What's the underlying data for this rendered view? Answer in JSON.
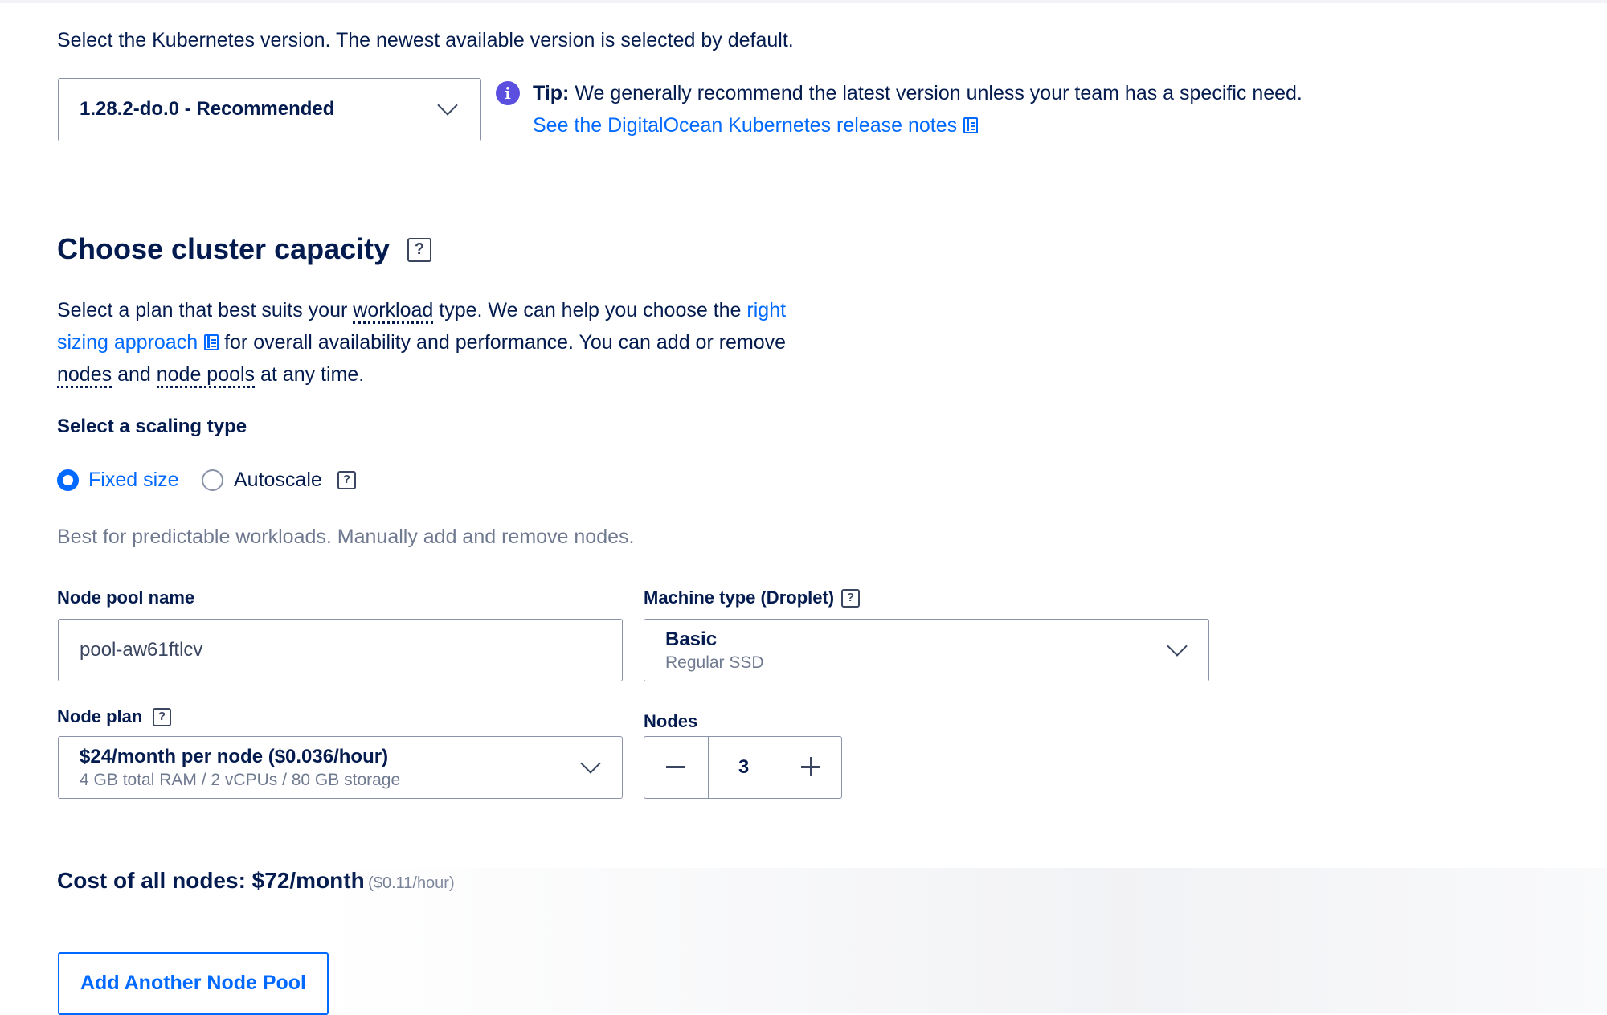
{
  "version_section": {
    "description": "Select the Kubernetes version. The newest available version is selected by default.",
    "selected_version": "1.28.2-do.0 - Recommended",
    "tip_label": "Tip:",
    "tip_text": "We generally recommend the latest version unless your team has a specific need.",
    "release_notes_link": "See the DigitalOcean Kubernetes release notes"
  },
  "capacity": {
    "title": "Choose cluster capacity",
    "desc_part1": "Select a plan that best suits your ",
    "desc_workload": "workload",
    "desc_part2": " type. We can help you choose the ",
    "desc_link_1": "right",
    "desc_link_2": "sizing approach",
    "desc_part3": " for overall availability and performance. You can add or remove",
    "desc_nodes": "nodes",
    "desc_and": " and ",
    "desc_node_pools": "node pools",
    "desc_part4": " at any time.",
    "scaling_label": "Select a scaling type",
    "scaling_options": [
      {
        "label": "Fixed size",
        "selected": true
      },
      {
        "label": "Autoscale",
        "selected": false
      }
    ],
    "scaling_hint": "Best for predictable workloads. Manually add and remove nodes."
  },
  "node_pool": {
    "name_label": "Node pool name",
    "name_value": "pool-aw61ftlcv",
    "machine_label": "Machine type (Droplet)",
    "machine_title": "Basic",
    "machine_sub": "Regular SSD",
    "plan_label": "Node plan",
    "plan_title": "$24/month per node ($0.036/hour)",
    "plan_sub": "4 GB total RAM / 2 vCPUs / 80 GB storage",
    "nodes_label": "Nodes",
    "nodes_value": "3"
  },
  "cost": {
    "label": "Cost of all nodes: $72/month",
    "hourly": "($0.11/hour)"
  },
  "actions": {
    "add_pool": "Add Another Node Pool"
  },
  "colors": {
    "accent": "#0069ff",
    "text": "#031b4e",
    "info": "#5b4fe0"
  }
}
